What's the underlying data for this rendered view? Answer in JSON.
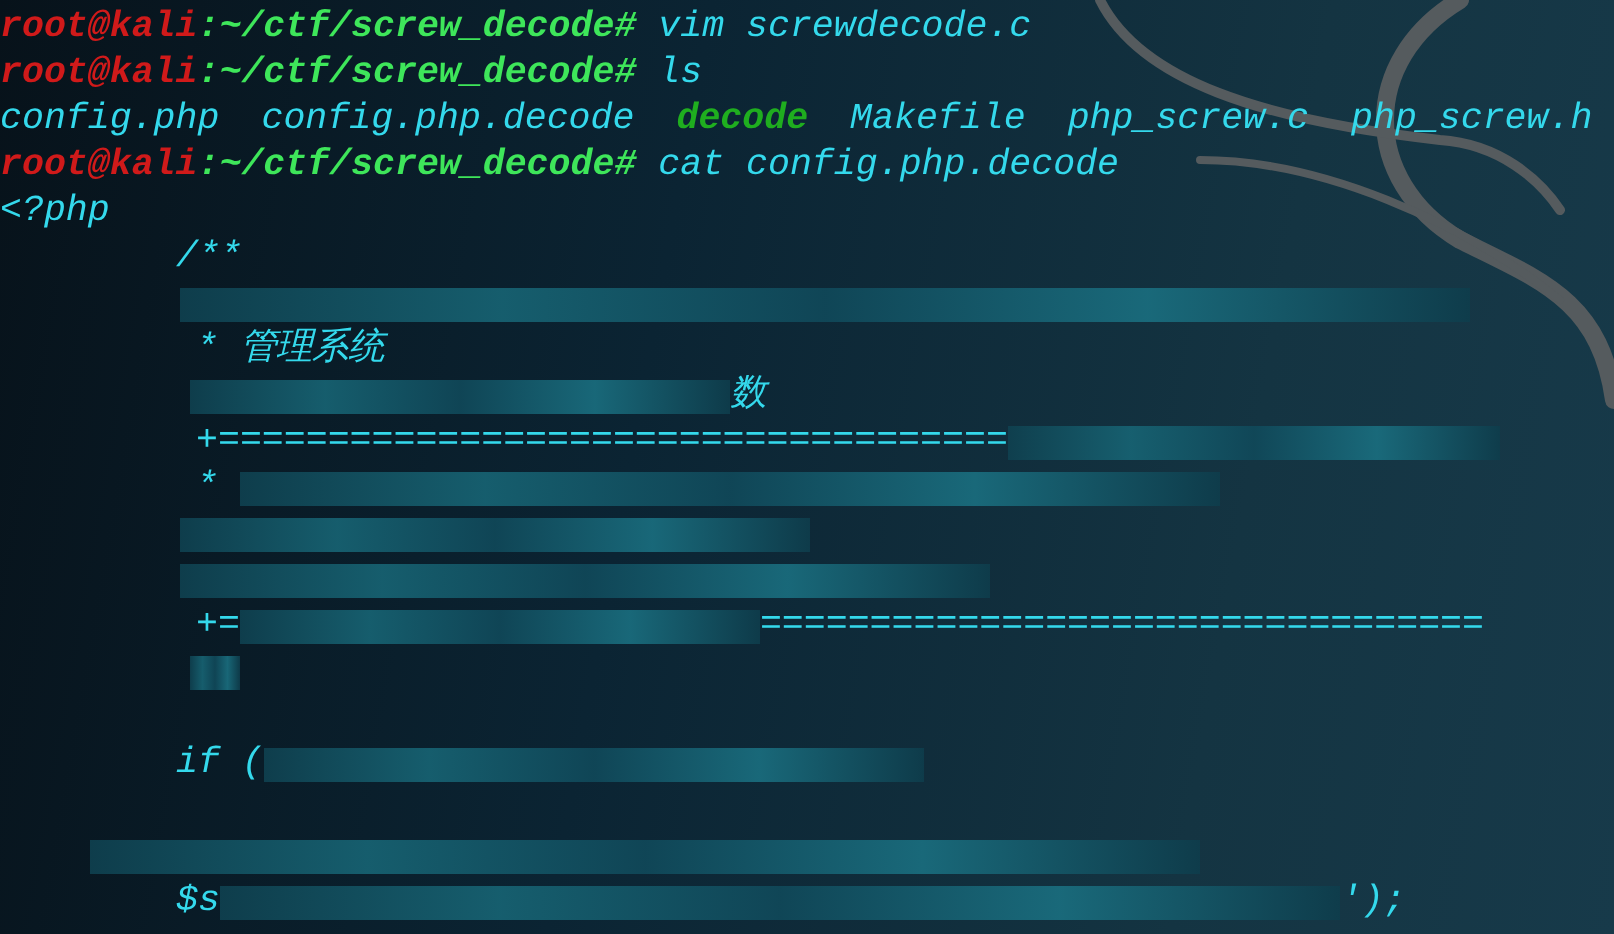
{
  "terminal": {
    "lines": [
      {
        "kind": "output",
        "segments": [
          {
            "kind": "user",
            "text": "root@kali"
          },
          {
            "kind": "path",
            "text": ":~/ctf/screw_decode#"
          },
          {
            "kind": "command",
            "text": " vim screwdecode.c"
          }
        ]
      },
      {
        "kind": "output",
        "segments": [
          {
            "kind": "user",
            "text": "root@kali"
          },
          {
            "kind": "path",
            "text": ":~/ctf/screw_decode#"
          },
          {
            "kind": "command",
            "text": " ls"
          }
        ]
      },
      {
        "kind": "output",
        "segments": [
          {
            "kind": "file",
            "text": "config.php"
          },
          {
            "kind": "file",
            "text": "config.php.decode"
          },
          {
            "kind": "exec",
            "text": "decode"
          },
          {
            "kind": "file",
            "text": "Makefile"
          },
          {
            "kind": "file",
            "text": "php_screw.c"
          },
          {
            "kind": "file",
            "text": "php_screw.h"
          }
        ]
      },
      {
        "kind": "output",
        "segments": [
          {
            "kind": "user",
            "text": "root@kali"
          },
          {
            "kind": "path",
            "text": ":~/ctf/screw_decode#"
          },
          {
            "kind": "command",
            "text": " cat config.php.decode"
          }
        ]
      },
      {
        "kind": "output",
        "segments": [
          {
            "kind": "code",
            "text": "<?php"
          }
        ]
      },
      {
        "kind": "output",
        "segments": [
          {
            "kind": "code",
            "text": "/**"
          }
        ]
      },
      {
        "kind": "output",
        "segments": [
          {
            "kind": "redacted"
          }
        ]
      },
      {
        "kind": "output",
        "segments": [
          {
            "kind": "code",
            "text": "* 管理系统"
          }
        ]
      },
      {
        "kind": "output",
        "segments": [
          {
            "kind": "redacted"
          },
          {
            "kind": "code",
            "text": "数"
          }
        ]
      },
      {
        "kind": "output",
        "segments": [
          {
            "kind": "code",
            "text": "+===================================="
          },
          {
            "kind": "redacted"
          }
        ]
      },
      {
        "kind": "output",
        "segments": [
          {
            "kind": "code",
            "text": "* "
          },
          {
            "kind": "redacted"
          }
        ]
      },
      {
        "kind": "output",
        "segments": [
          {
            "kind": "redacted"
          }
        ]
      },
      {
        "kind": "output",
        "segments": [
          {
            "kind": "redacted"
          }
        ]
      },
      {
        "kind": "output",
        "segments": [
          {
            "kind": "code",
            "text": "+="
          },
          {
            "kind": "redacted"
          },
          {
            "kind": "code",
            "text": "================================="
          }
        ]
      },
      {
        "kind": "output",
        "segments": [
          {
            "kind": "redacted"
          }
        ]
      },
      {
        "kind": "blank"
      },
      {
        "kind": "output",
        "segments": [
          {
            "kind": "code",
            "text": "if ("
          },
          {
            "kind": "redacted"
          }
        ]
      },
      {
        "kind": "blank"
      },
      {
        "kind": "output",
        "segments": [
          {
            "kind": "redacted"
          }
        ]
      },
      {
        "kind": "output",
        "segments": [
          {
            "kind": "code",
            "text": "$s"
          },
          {
            "kind": "redacted"
          },
          {
            "kind": "code",
            "text": "');"
          }
        ]
      }
    ]
  }
}
